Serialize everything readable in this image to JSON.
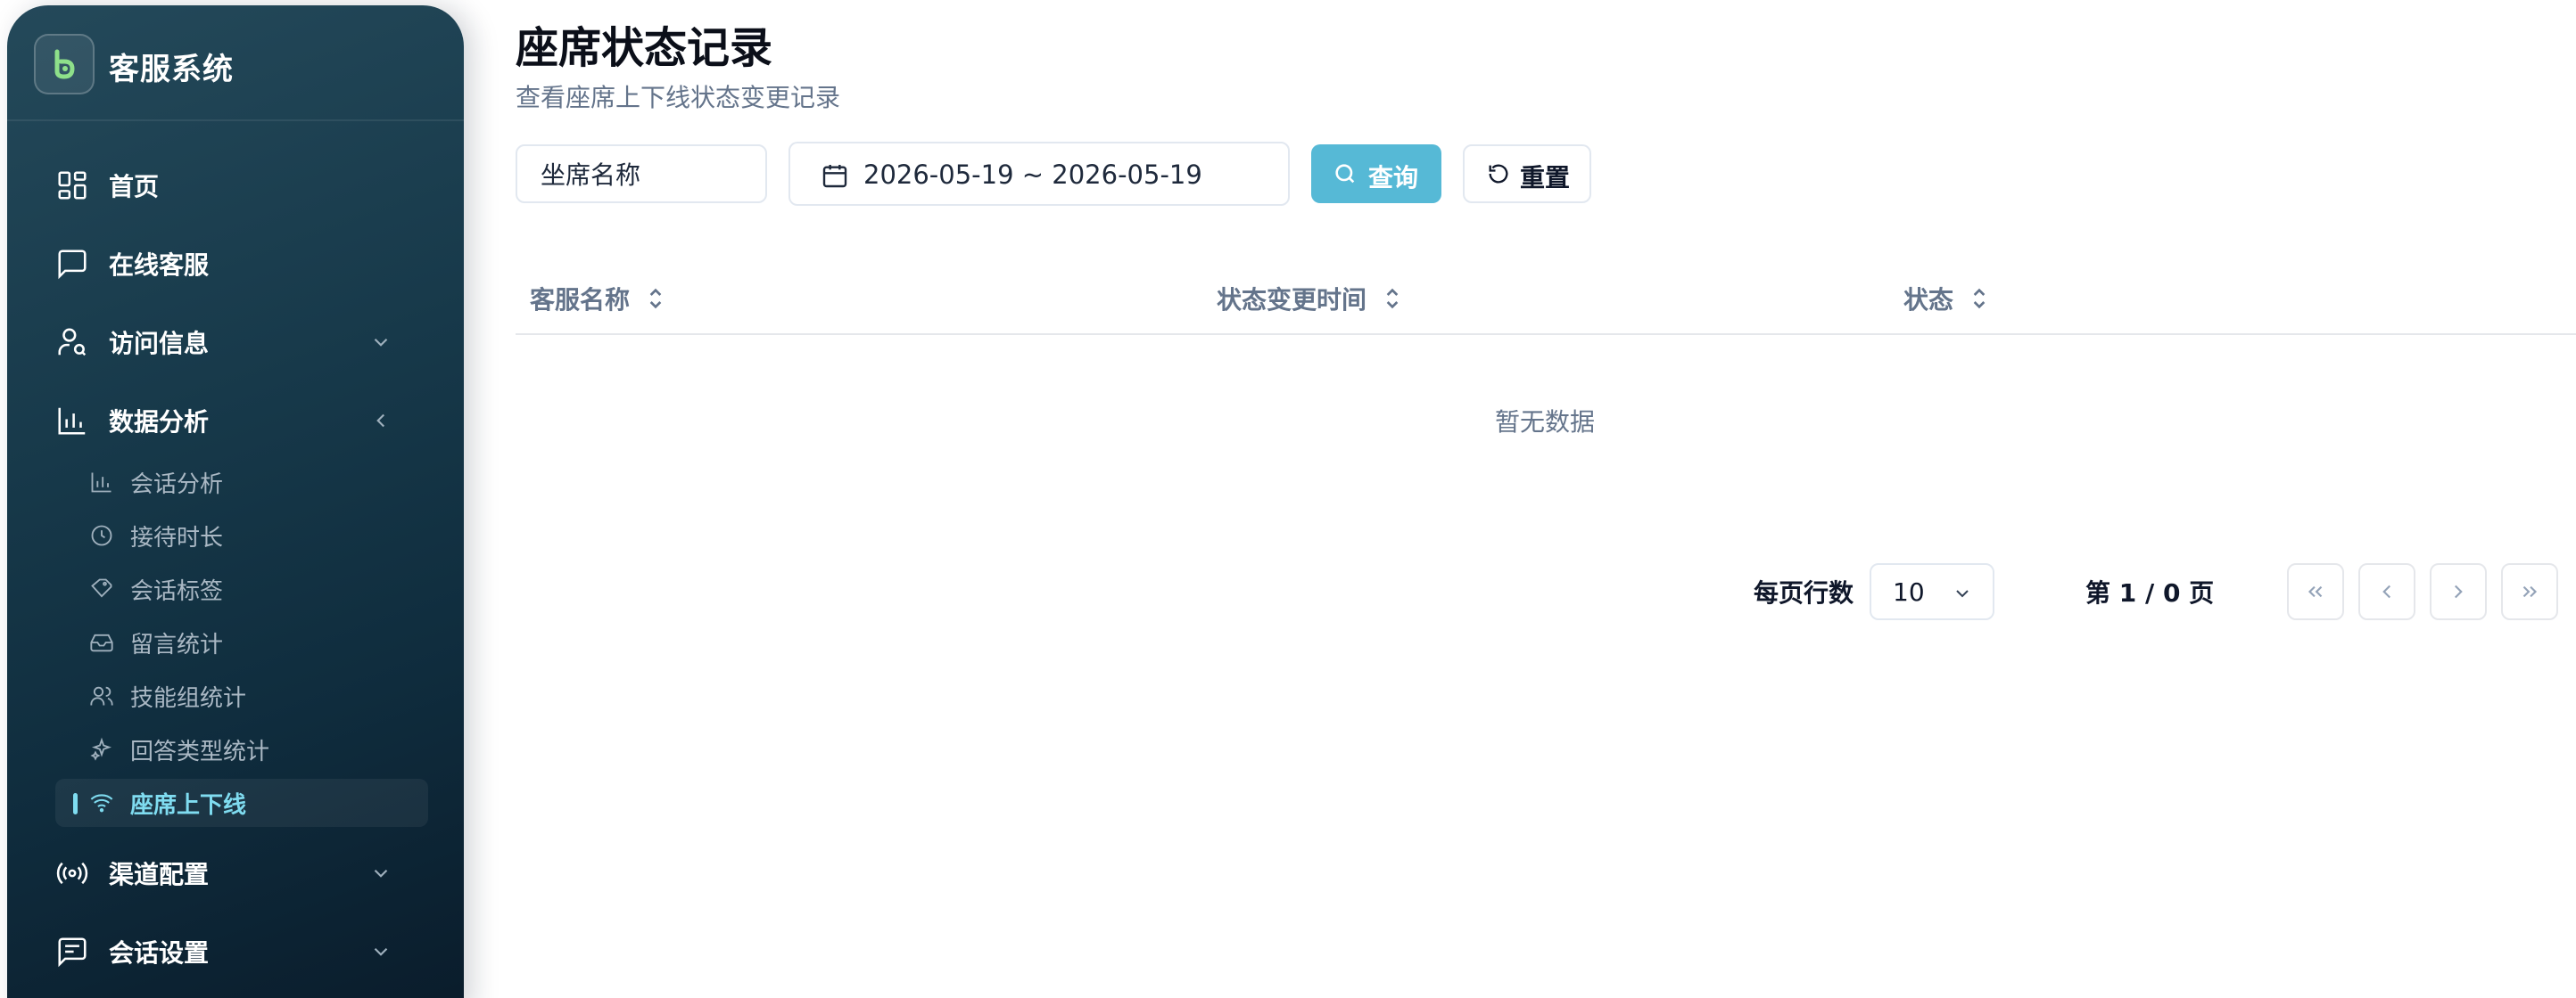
{
  "brand": {
    "title": "客服系统",
    "logo_icon": "chat-bot-logo"
  },
  "sidebar": {
    "items": [
      {
        "label": "首页",
        "icon": "dashboard-icon"
      },
      {
        "label": "在线客服",
        "icon": "message-square-icon"
      },
      {
        "label": "访问信息",
        "icon": "user-search-icon",
        "expanded": false
      },
      {
        "label": "数据分析",
        "icon": "bar-chart-icon",
        "expanded": true
      },
      {
        "label": "渠道配置",
        "icon": "radio-broadcast-icon",
        "expanded": false
      },
      {
        "label": "会话设置",
        "icon": "message-settings-icon",
        "expanded": false
      }
    ],
    "analysis_children": [
      {
        "label": "会话分析",
        "icon": "bar-chart-icon"
      },
      {
        "label": "接待时长",
        "icon": "clock-icon"
      },
      {
        "label": "会话标签",
        "icon": "tags-icon"
      },
      {
        "label": "留言统计",
        "icon": "inbox-icon"
      },
      {
        "label": "技能组统计",
        "icon": "users-icon"
      },
      {
        "label": "回答类型统计",
        "icon": "sparkles-icon"
      },
      {
        "label": "座席上下线",
        "icon": "wifi-icon",
        "active": true
      }
    ]
  },
  "header": {
    "title": "座席状态记录",
    "subtitle": "查看座席上下线状态变更记录"
  },
  "filters": {
    "agent_name_placeholder": "坐席名称",
    "date_range": "2026-05-19 ~ 2026-05-19",
    "query_label": "查询",
    "reset_label": "重置"
  },
  "table": {
    "columns": [
      "客服名称",
      "状态变更时间",
      "状态"
    ],
    "empty_text": "暂无数据",
    "rows": []
  },
  "pagination": {
    "rows_per_page_label": "每页行数",
    "rows_per_page": "10",
    "page_info": "第 1 / 0 页"
  },
  "colors": {
    "accent": "#56b9d6",
    "sidebar_active": "#7fdcf0",
    "sidebar_bg": "#17394a"
  }
}
